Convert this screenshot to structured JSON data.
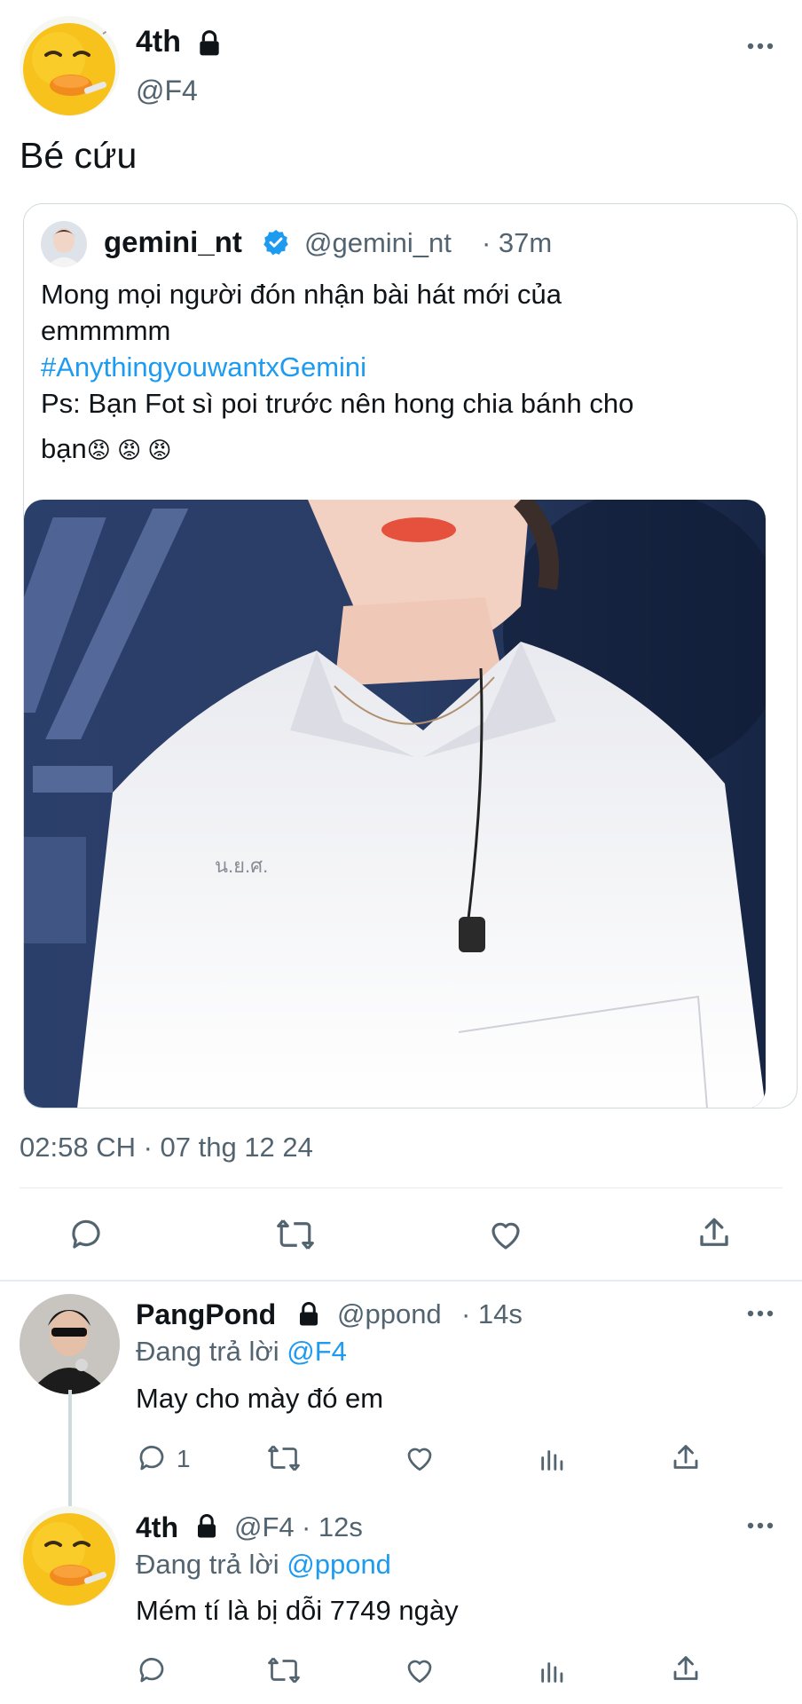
{
  "main_tweet": {
    "display_name": "4th",
    "handle": "@F4",
    "text": "Bé cứu",
    "timestamp": "02:58 CH · 07 thg 12 24",
    "icons": [
      "reply-icon",
      "retweet-icon",
      "like-icon",
      "share-icon"
    ]
  },
  "quoted_tweet": {
    "display_name": "gemini_nt",
    "handle": "@gemini_nt",
    "time": "· 37m",
    "line1": "Mong mọi người đón nhận bài hát mới của",
    "line2": "emmmmm",
    "hashtag": "#AnythingyouwantxGemini",
    "line3": "Ps: Bạn Fot sì poi trước nên hong chia bánh cho",
    "line4": "bạn",
    "emojis": "😡 😡 😡",
    "shirt_text": "น.ย.ศ."
  },
  "reply1": {
    "display_name": "PangPond",
    "handle": "@ppond",
    "time": "· 14s",
    "replying_prefix": "Đang trả lời",
    "replying_to": "@F4",
    "text": "May cho mày đó em",
    "reply_count": "1"
  },
  "reply2": {
    "display_name": "4th",
    "handle": "@F4",
    "time": "· 12s",
    "replying_prefix": "Đang trả lời",
    "replying_to": "@ppond",
    "text": "Mém tí là bị dỗi 7749 ngày"
  },
  "colors": {
    "text": "#0f1419",
    "muted": "#536471",
    "link": "#1d9bf0",
    "verified": "#1d9bf0",
    "border": "#cfd9de"
  }
}
